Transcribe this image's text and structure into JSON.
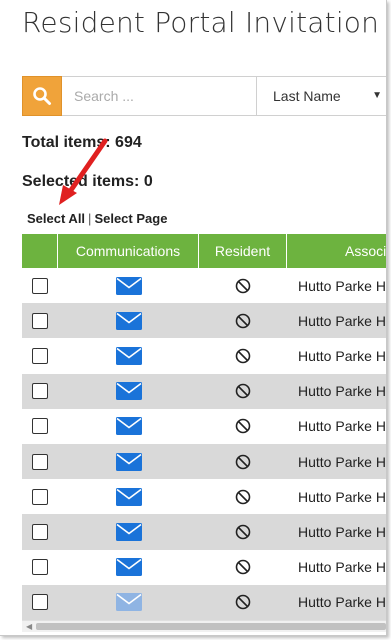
{
  "page": {
    "title": "Resident Portal Invitation"
  },
  "search": {
    "placeholder": "Search ...",
    "sort_value": "Last Name"
  },
  "summary": {
    "total_label": "Total items: 694",
    "selected_label": "Selected items: 0"
  },
  "selection": {
    "select_all": "Select All",
    "separator": "|",
    "select_page": "Select Page"
  },
  "table": {
    "headers": {
      "communications": "Communications",
      "resident": "Resident",
      "association": "Associ"
    },
    "rows": [
      {
        "association": "Hutto Parke H",
        "mail_state": "active"
      },
      {
        "association": "Hutto Parke H",
        "mail_state": "active"
      },
      {
        "association": "Hutto Parke H",
        "mail_state": "active"
      },
      {
        "association": "Hutto Parke H",
        "mail_state": "active"
      },
      {
        "association": "Hutto Parke H",
        "mail_state": "active"
      },
      {
        "association": "Hutto Parke H",
        "mail_state": "active"
      },
      {
        "association": "Hutto Parke H",
        "mail_state": "active"
      },
      {
        "association": "Hutto Parke H",
        "mail_state": "active"
      },
      {
        "association": "Hutto Parke H",
        "mail_state": "active"
      },
      {
        "association": "Hutto Parke H",
        "mail_state": "faded"
      }
    ]
  },
  "colors": {
    "header_green": "#6db33f",
    "search_orange": "#f0a33a",
    "mail_blue": "#1a73d9",
    "mail_faded": "#8fb4e3",
    "row_alt": "#d9d9d9",
    "annotation_red": "#e02020"
  },
  "icons": {
    "search": "search-icon",
    "mail": "envelope-icon",
    "resident": "ban-icon",
    "dropdown": "caret-down-icon"
  }
}
